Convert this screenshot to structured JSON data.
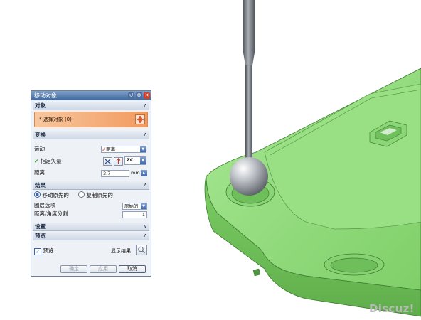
{
  "dialog": {
    "title": "移动对象",
    "title_icons": [
      "reset-icon",
      "settings-icon",
      "close-icon"
    ],
    "sections": {
      "object": {
        "label": "对象",
        "select_label": "* 选择对象 (0)"
      },
      "transform": {
        "label": "变换",
        "motion_label": "运动",
        "motion_value": "距离",
        "vector_label": "指定矢量",
        "vector_value": "ZC",
        "distance_label": "距离",
        "distance_value": "3.7",
        "distance_unit": "mm"
      },
      "result": {
        "label": "结果",
        "move_original": "移动原先的",
        "copy_original": "复制原先的",
        "layer_label": "图层选项",
        "layer_value": "原始的",
        "segments_label": "距离/角度分割",
        "segments_value": "1"
      },
      "settings": {
        "label": "设置"
      },
      "preview": {
        "label": "预览",
        "preview_checkbox": "预览",
        "show_result": "显示结果"
      }
    },
    "buttons": {
      "ok": "确定",
      "apply": "应用",
      "cancel": "取消"
    }
  },
  "colors": {
    "model_green": "#8fd97a",
    "select_highlight": "#f4b889",
    "title_blue": "#3f679c"
  },
  "watermark": "Discuz!"
}
